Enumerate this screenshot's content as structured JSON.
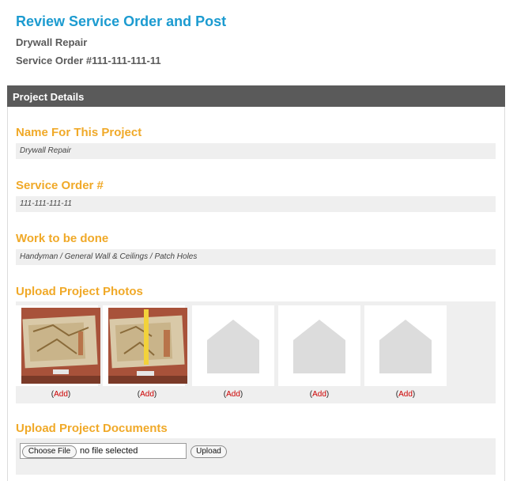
{
  "header": {
    "title": "Review Service Order and Post",
    "project_name": "Drywall Repair",
    "service_order_line": "Service Order #111-111-111-11"
  },
  "panel": {
    "title": "Project Details"
  },
  "fields": {
    "name": {
      "label": "Name For This Project",
      "value": "Drywall Repair"
    },
    "service_order": {
      "label": "Service Order #",
      "value": "111-111-111-11"
    },
    "work": {
      "label": "Work to be done",
      "value": "Handyman / General Wall & Ceilings / Patch Holes"
    }
  },
  "photos": {
    "label": "Upload Project Photos",
    "slots": [
      {
        "kind": "photo",
        "icon": "drywall-photo",
        "paren_open": "(",
        "add": "Add",
        "paren_close": ")"
      },
      {
        "kind": "photo",
        "icon": "drywall-photo-with-tape-measure",
        "paren_open": "(",
        "add": "Add",
        "paren_close": ")"
      },
      {
        "kind": "placeholder",
        "icon": "house-placeholder-icon",
        "paren_open": "(",
        "add": "Add",
        "paren_close": ")"
      },
      {
        "kind": "placeholder",
        "icon": "house-placeholder-icon",
        "paren_open": "(",
        "add": "Add",
        "paren_close": ")"
      },
      {
        "kind": "placeholder",
        "icon": "house-placeholder-icon",
        "paren_open": "(",
        "add": "Add",
        "paren_close": ")"
      }
    ]
  },
  "documents": {
    "label": "Upload Project Documents",
    "choose_button": "Choose File",
    "file_status": "no file selected",
    "upload_button": "Upload"
  },
  "colors": {
    "title_blue": "#1c9bd0",
    "section_orange": "#f0a928",
    "header_gray": "#5a5a5a",
    "add_red": "#cc0000"
  }
}
